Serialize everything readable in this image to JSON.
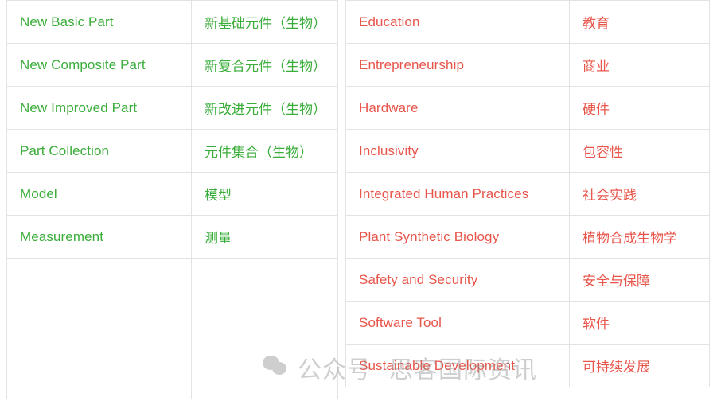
{
  "page": {
    "background_color": "#ffffff",
    "border_color": "#e3e3e3"
  },
  "colors": {
    "green": "#3aad3a",
    "red": "#e8554a",
    "watermark": "#8c8c8c"
  },
  "left_table": {
    "accent_color": "#3aad3a",
    "rows": [
      {
        "en": "New Basic Part",
        "zh": "新基础元件（生物）"
      },
      {
        "en": "New Composite Part",
        "zh": "新复合元件（生物）"
      },
      {
        "en": "New Improved Part",
        "zh": "新改进元件（生物）"
      },
      {
        "en": "Part Collection",
        "zh": "元件集合（生物）"
      },
      {
        "en": "Model",
        "zh": "模型"
      },
      {
        "en": "Measurement",
        "zh": "测量"
      }
    ],
    "filler_row": {
      "en": "",
      "zh": ""
    }
  },
  "right_table": {
    "accent_color": "#e8554a",
    "rows": [
      {
        "en": "Education",
        "zh": "教育"
      },
      {
        "en": "Entrepreneurship",
        "zh": "商业"
      },
      {
        "en": "Hardware",
        "zh": "硬件"
      },
      {
        "en": "Inclusivity",
        "zh": "包容性"
      },
      {
        "en": "Integrated Human Practices",
        "zh": "社会实践"
      },
      {
        "en": "Plant Synthetic Biology",
        "zh": "植物合成生物学"
      },
      {
        "en": "Safety and Security",
        "zh": "安全与保障"
      },
      {
        "en": "Software Tool",
        "zh": "软件"
      },
      {
        "en": "Sustainable Development",
        "zh": "可持续发展"
      }
    ]
  },
  "watermark": {
    "icon": "wechat-logo-icon",
    "text_a": "公众号",
    "text_b": "思客国际资讯"
  }
}
